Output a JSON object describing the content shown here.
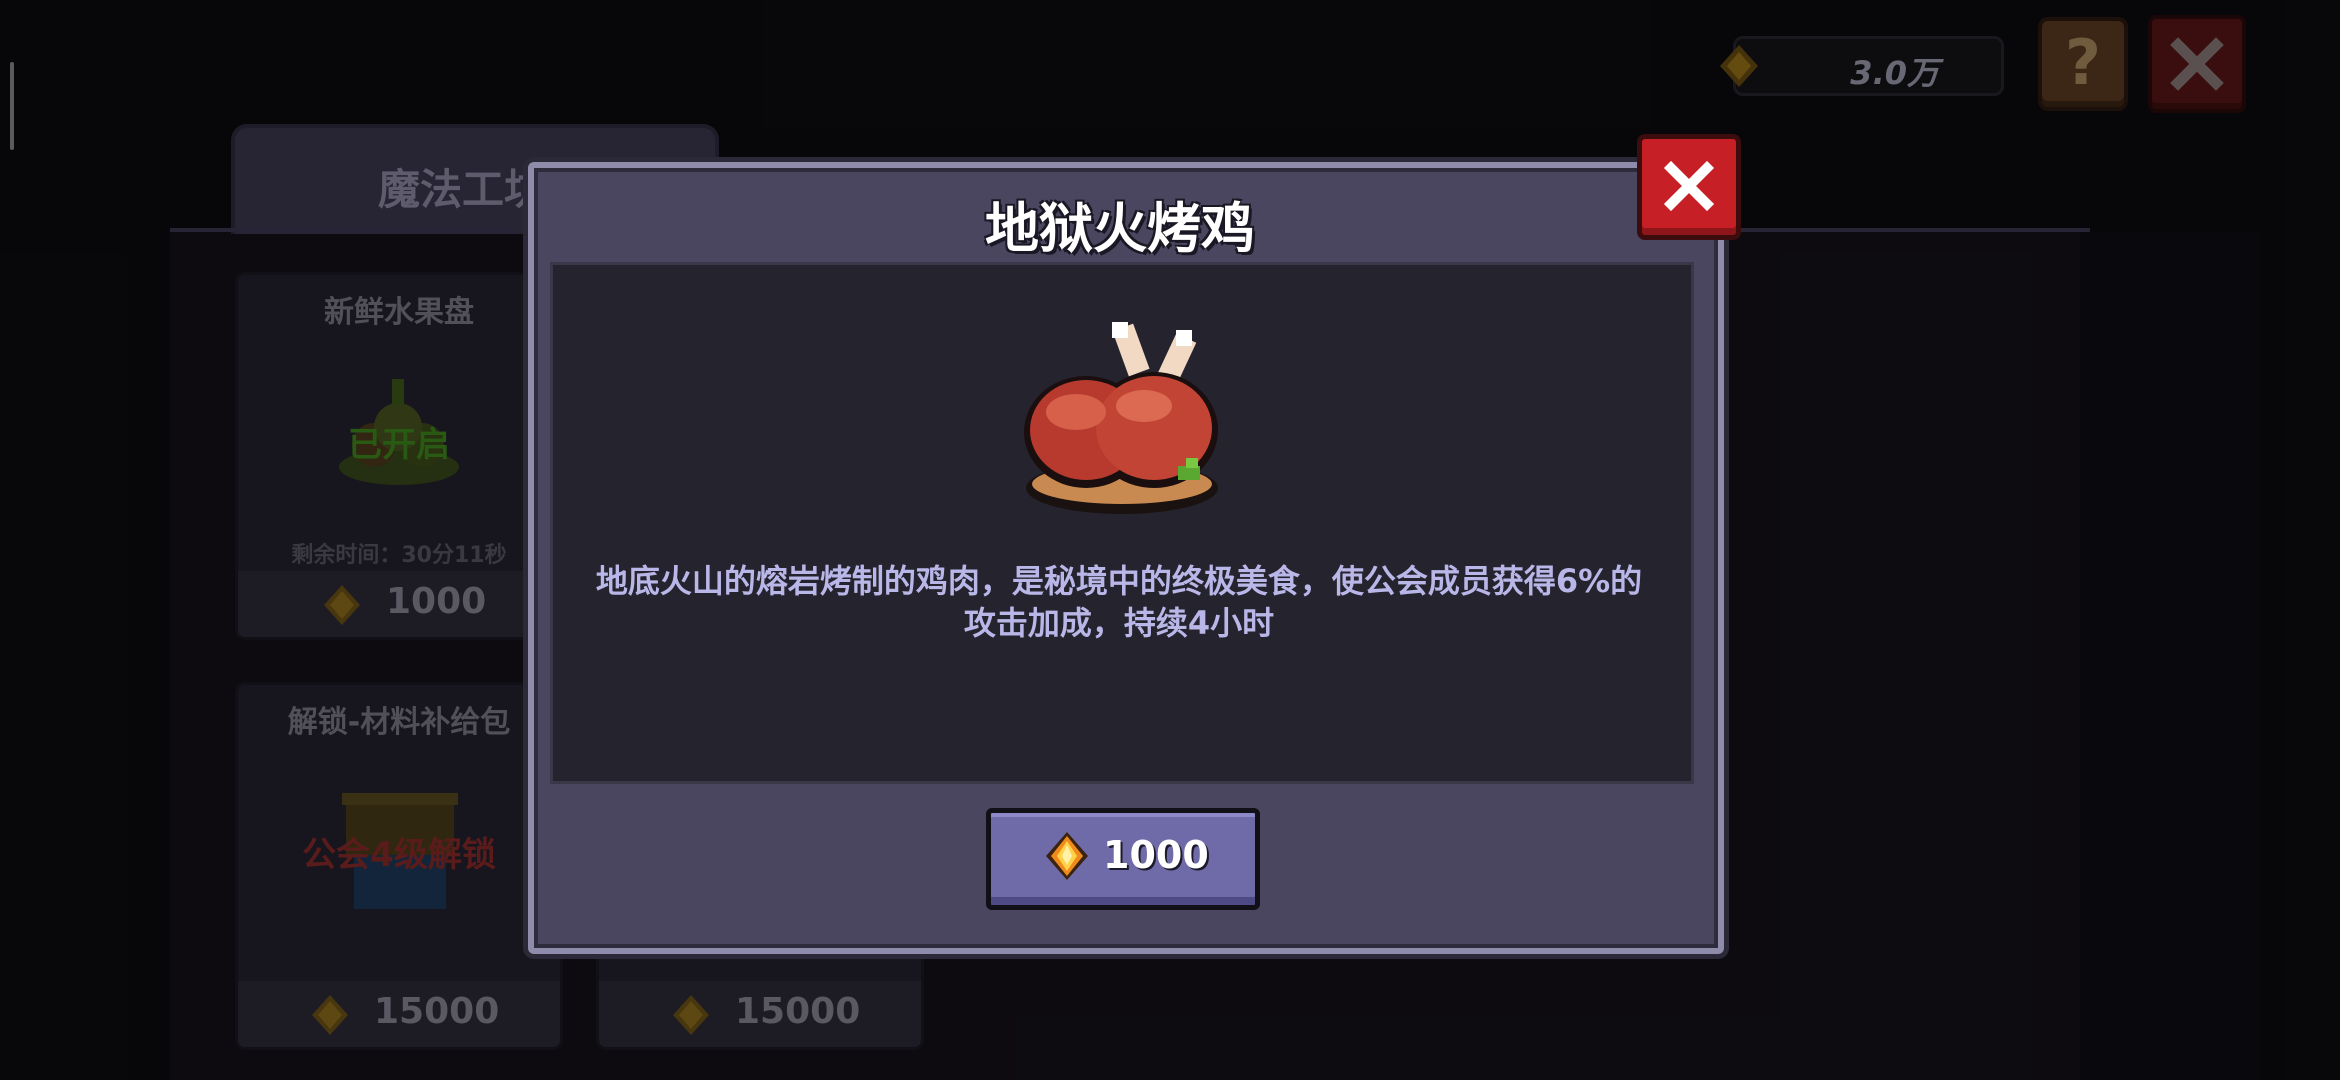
{
  "hud": {
    "currency_value": "3.0万",
    "help_label": "?"
  },
  "shop": {
    "tab_label": "魔法工坊",
    "cards": [
      {
        "title": "新鲜水果盘",
        "status": "已开启",
        "timer": "剩余时间：30分11秒",
        "price": "1000"
      },
      {
        "title": "解锁-材料补给包",
        "status": "公会4级解锁",
        "price": "15000"
      },
      {
        "price": "15000"
      }
    ]
  },
  "modal": {
    "title": "地狱火烤鸡",
    "description_line1": "地底火山的熔岩烤制的鸡肉，是秘境中的终极美食，使公会成员获得6%的",
    "description_line2": "攻击加成，持续4小时",
    "price": "1000"
  },
  "colors": {
    "accent_purple": "#6f6aa8",
    "close_red": "#c61f25",
    "status_green": "#3f7a1e",
    "status_red": "#8a2a2a"
  },
  "icons": [
    "gem-icon",
    "help-icon",
    "close-icon",
    "roast-chicken-icon"
  ]
}
